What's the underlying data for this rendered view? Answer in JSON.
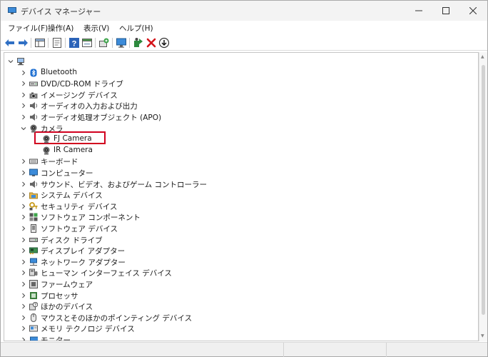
{
  "window": {
    "title": "デバイス マネージャー"
  },
  "menu": [
    "ファイル(F)",
    "操作(A)",
    "表示(V)",
    "ヘルプ(H)"
  ],
  "toolbar": [
    {
      "icon": "back-arrow-icon"
    },
    {
      "icon": "forward-arrow-icon"
    },
    {
      "sep": true
    },
    {
      "icon": "show-hide-tree-icon"
    },
    {
      "sep": true
    },
    {
      "icon": "properties-icon"
    },
    {
      "sep": true
    },
    {
      "icon": "help-icon"
    },
    {
      "icon": "view-panel-icon"
    },
    {
      "sep": true
    },
    {
      "icon": "scan-hardware-icon"
    },
    {
      "sep": true
    },
    {
      "icon": "monitor-icon"
    },
    {
      "sep": true
    },
    {
      "icon": "update-driver-icon"
    },
    {
      "icon": "uninstall-x-icon"
    },
    {
      "icon": "download-circle-icon"
    }
  ],
  "tree": [
    {
      "depth": 0,
      "state": "expanded",
      "icon": "computer-icon",
      "label": ""
    },
    {
      "depth": 1,
      "state": "collapsed",
      "icon": "bluetooth-icon",
      "label": "Bluetooth"
    },
    {
      "depth": 1,
      "state": "collapsed",
      "icon": "dvd-drive-icon",
      "label": "DVD/CD-ROM ドライブ"
    },
    {
      "depth": 1,
      "state": "collapsed",
      "icon": "imaging-device-icon",
      "label": "イメージング デバイス"
    },
    {
      "depth": 1,
      "state": "collapsed",
      "icon": "speaker-icon",
      "label": "オーディオの入力および出力"
    },
    {
      "depth": 1,
      "state": "collapsed",
      "icon": "speaker-icon",
      "label": "オーディオ処理オブジェクト (APO)"
    },
    {
      "depth": 1,
      "state": "expanded",
      "icon": "camera-icon",
      "label": "カメラ"
    },
    {
      "depth": 2,
      "state": "none",
      "icon": "camera-icon",
      "label": "FJ Camera"
    },
    {
      "depth": 2,
      "state": "none",
      "icon": "camera-icon",
      "label": "IR Camera"
    },
    {
      "depth": 1,
      "state": "collapsed",
      "icon": "keyboard-icon",
      "label": "キーボード"
    },
    {
      "depth": 1,
      "state": "collapsed",
      "icon": "computer-monitor-icon",
      "label": "コンピューター"
    },
    {
      "depth": 1,
      "state": "collapsed",
      "icon": "speaker-icon",
      "label": "サウンド、ビデオ、およびゲーム コントローラー"
    },
    {
      "depth": 1,
      "state": "collapsed",
      "icon": "system-folder-icon",
      "label": "システム デバイス"
    },
    {
      "depth": 1,
      "state": "collapsed",
      "icon": "security-key-icon",
      "label": "セキュリティ デバイス"
    },
    {
      "depth": 1,
      "state": "collapsed",
      "icon": "software-component-icon",
      "label": "ソフトウェア コンポーネント"
    },
    {
      "depth": 1,
      "state": "collapsed",
      "icon": "software-device-icon",
      "label": "ソフトウェア デバイス"
    },
    {
      "depth": 1,
      "state": "collapsed",
      "icon": "disk-drive-icon",
      "label": "ディスク ドライブ"
    },
    {
      "depth": 1,
      "state": "collapsed",
      "icon": "display-adapter-icon",
      "label": "ディスプレイ アダプター"
    },
    {
      "depth": 1,
      "state": "collapsed",
      "icon": "network-adapter-icon",
      "label": "ネットワーク アダプター"
    },
    {
      "depth": 1,
      "state": "collapsed",
      "icon": "hid-icon",
      "label": "ヒューマン インターフェイス デバイス"
    },
    {
      "depth": 1,
      "state": "collapsed",
      "icon": "firmware-icon",
      "label": "ファームウェア"
    },
    {
      "depth": 1,
      "state": "collapsed",
      "icon": "processor-icon",
      "label": "プロセッサ"
    },
    {
      "depth": 1,
      "state": "collapsed",
      "icon": "other-devices-icon",
      "label": "ほかのデバイス"
    },
    {
      "depth": 1,
      "state": "collapsed",
      "icon": "mouse-icon",
      "label": "マウスとそのほかのポインティング デバイス"
    },
    {
      "depth": 1,
      "state": "collapsed",
      "icon": "memory-technology-icon",
      "label": "メモリ テクノロジ デバイス"
    },
    {
      "depth": 1,
      "state": "collapsed",
      "icon": "monitor-icon",
      "label": "モニター"
    }
  ],
  "colors": {
    "highlight_border": "#d1001f",
    "accent_blue": "#1e6fd1"
  }
}
